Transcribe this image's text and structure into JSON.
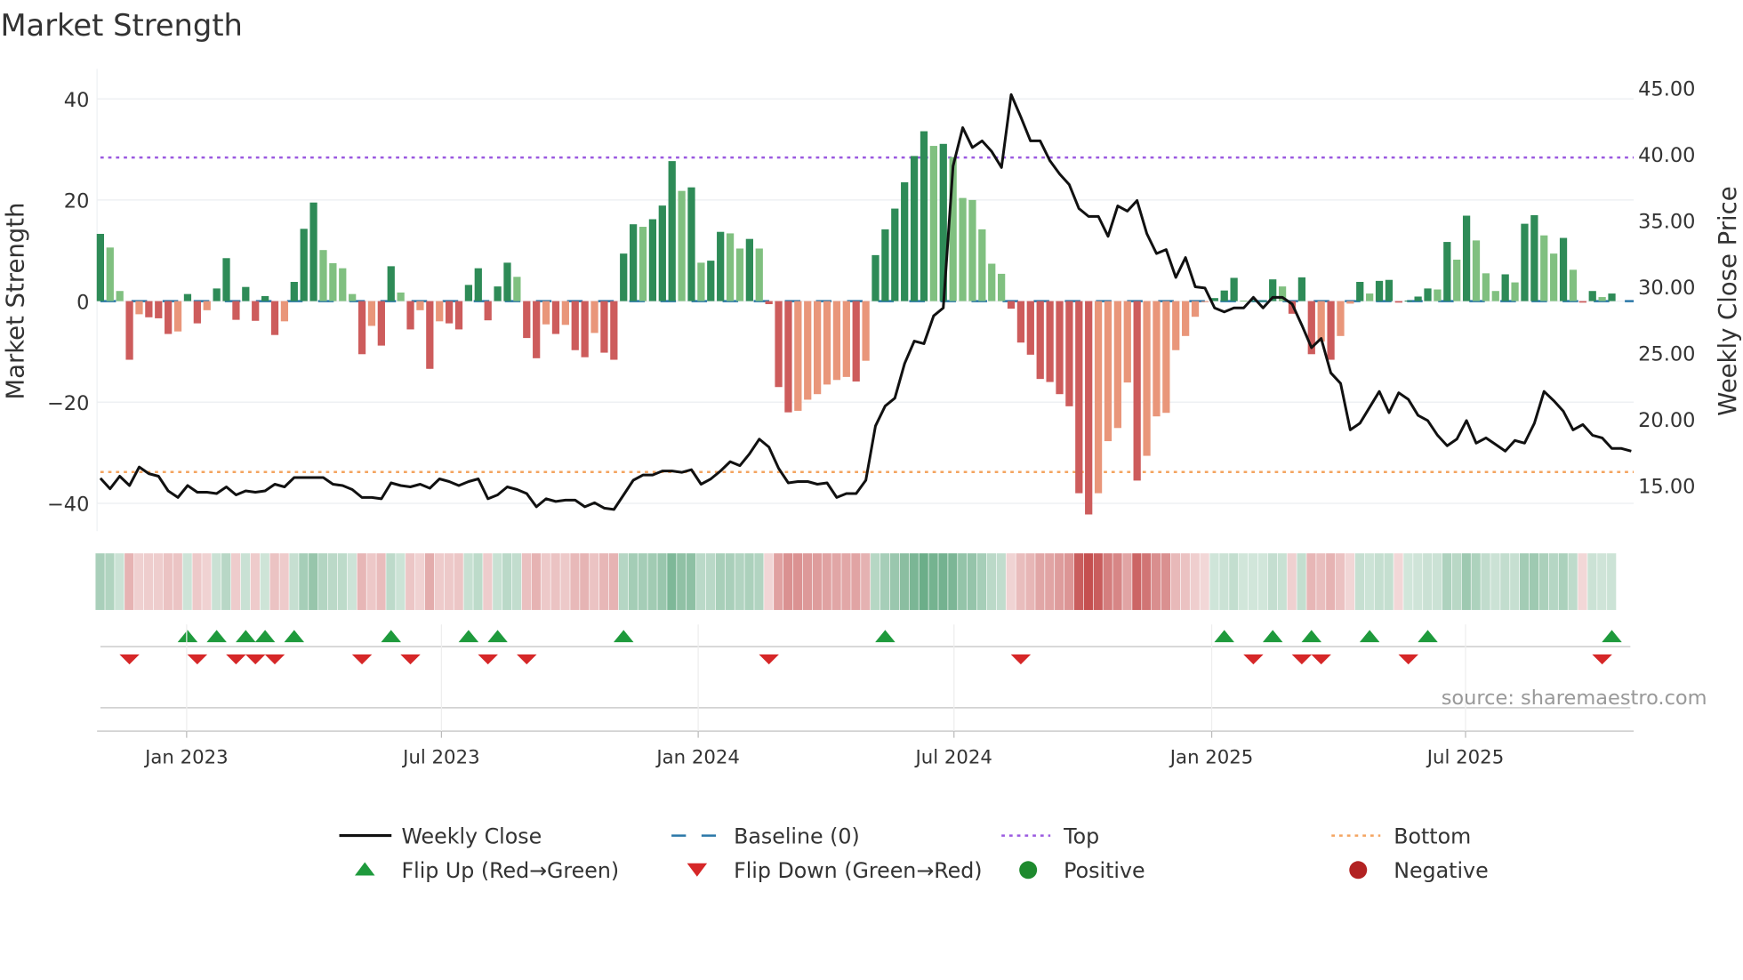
{
  "chart_data": {
    "type": "bar",
    "title": "Market Strength",
    "ylabel": "Market Strength",
    "y2label": "Weekly Close Price",
    "ylim": [
      -45,
      45
    ],
    "y2lim": [
      12.8,
      46.3
    ],
    "yticks": [
      40,
      20,
      0,
      -20,
      -40
    ],
    "yticklabels": [
      "40",
      "20",
      "0",
      "−20",
      "−40"
    ],
    "y2ticks": [
      45,
      40,
      35,
      30,
      25,
      20,
      15
    ],
    "y2ticklabels": [
      "45.00",
      "40.00",
      "35.00",
      "30.00",
      "25.00",
      "20.00",
      "15.00"
    ],
    "x_ticks": [
      {
        "label": "Jan 2023",
        "week": 8.9
      },
      {
        "label": "Jul 2023",
        "week": 35.2
      },
      {
        "label": "Jan 2024",
        "week": 61.7
      },
      {
        "label": "Jul 2024",
        "week": 88.1
      },
      {
        "label": "Jan 2025",
        "week": 114.7
      },
      {
        "label": "Jul 2025",
        "week": 140.9
      }
    ],
    "top_level": 28.4,
    "bottom_level": -33.8,
    "strength": [
      13.3,
      10.6,
      2.0,
      -11.6,
      -2.6,
      -3.2,
      -3.4,
      -6.5,
      -6.0,
      1.4,
      -4.4,
      -1.8,
      2.5,
      8.5,
      -3.7,
      2.8,
      -3.9,
      1.0,
      -6.7,
      -4.0,
      3.8,
      14.3,
      19.5,
      10.1,
      7.5,
      6.5,
      1.4,
      -10.5,
      -4.9,
      -8.8,
      6.9,
      1.7,
      -5.6,
      -1.8,
      -13.4,
      -4.0,
      -4.4,
      -5.6,
      3.2,
      6.5,
      -3.8,
      2.9,
      7.6,
      4.8,
      -7.3,
      -11.3,
      -4.6,
      -6.5,
      -4.7,
      -9.7,
      -11.1,
      -6.3,
      -10.2,
      -11.6,
      9.4,
      15.2,
      14.7,
      16.2,
      18.9,
      27.7,
      21.8,
      22.5,
      7.6,
      8.0,
      13.7,
      13.4,
      10.4,
      12.3,
      10.4,
      -0.6,
      -17.0,
      -22.0,
      -21.7,
      -19.5,
      -18.4,
      -16.5,
      -15.6,
      -15.0,
      -15.9,
      -11.8,
      9.1,
      14.2,
      18.3,
      23.5,
      28.7,
      33.6,
      30.7,
      31.1,
      28.5,
      20.4,
      20.0,
      14.2,
      7.4,
      5.4,
      -1.5,
      -8.2,
      -10.6,
      -15.4,
      -16.0,
      -18.4,
      -20.8,
      -38.0,
      -42.2,
      -38.0,
      -27.7,
      -25.1,
      -16.1,
      -35.5,
      -30.6,
      -22.8,
      -22.1,
      -9.7,
      -6.9,
      -3.1,
      -0.2,
      0.6,
      2.1,
      4.6,
      0.1,
      0.1,
      0.1,
      4.3,
      2.9,
      -2.5,
      4.7,
      -10.5,
      -8.0,
      -11.6,
      -6.9,
      -0.5,
      3.8,
      1.5,
      4.0,
      4.2,
      -0.3,
      0.1,
      0.9,
      2.5,
      2.3,
      11.7,
      8.2,
      16.9,
      12.0,
      5.5,
      2.0,
      5.3,
      3.7,
      15.3,
      17.0,
      13.0,
      9.4,
      12.5,
      6.2,
      -0.3,
      2.0,
      0.8,
      1.5
    ],
    "weekly_close": [
      15.55,
      14.76,
      15.7,
      15.0,
      16.4,
      15.9,
      15.7,
      14.6,
      14.1,
      15.0,
      14.5,
      14.5,
      14.4,
      14.9,
      14.3,
      14.6,
      14.5,
      14.6,
      15.1,
      14.9,
      15.6,
      15.6,
      15.6,
      15.6,
      15.1,
      15.0,
      14.7,
      14.1,
      14.1,
      14.0,
      15.2,
      15.0,
      14.9,
      15.1,
      14.8,
      15.5,
      15.3,
      15.0,
      15.3,
      15.5,
      14.0,
      14.3,
      14.9,
      14.7,
      14.4,
      13.4,
      14.0,
      13.8,
      13.9,
      13.9,
      13.4,
      13.7,
      13.3,
      13.2,
      14.3,
      15.4,
      15.8,
      15.8,
      16.1,
      16.1,
      16.0,
      16.2,
      15.1,
      15.5,
      16.1,
      16.8,
      16.5,
      17.4,
      18.5,
      17.9,
      16.3,
      15.2,
      15.3,
      15.3,
      15.1,
      15.2,
      14.1,
      14.4,
      14.4,
      15.4,
      19.5,
      21.0,
      21.6,
      24.2,
      25.9,
      25.7,
      27.8,
      28.4,
      39.1,
      42.0,
      40.5,
      41.0,
      40.2,
      39.0,
      44.5,
      42.8,
      41.0,
      41.0,
      39.5,
      38.5,
      37.7,
      35.9,
      35.3,
      35.3,
      33.8,
      36.1,
      35.7,
      36.5,
      34.0,
      32.5,
      32.8,
      30.7,
      32.2,
      30.0,
      29.9,
      28.4,
      28.1,
      28.4,
      28.4,
      29.2,
      28.4,
      29.2,
      29.2,
      28.7,
      27.1,
      25.4,
      26.1,
      23.5,
      22.7,
      19.2,
      19.7,
      20.9,
      22.1,
      20.5,
      22.0,
      21.5,
      20.3,
      19.9,
      18.8,
      18.0,
      18.5,
      19.9,
      18.2,
      18.6,
      18.1,
      17.6,
      18.4,
      18.2,
      19.7,
      22.1,
      21.4,
      20.6,
      19.2,
      19.6,
      18.8,
      18.6,
      17.8,
      17.8,
      17.6
    ],
    "flip_up_weeks": [
      9,
      12,
      15,
      17,
      20,
      30,
      38,
      41,
      54,
      81,
      116,
      121,
      125,
      131,
      137,
      156
    ],
    "flip_down_weeks": [
      3,
      10,
      14,
      16,
      18,
      27,
      32,
      40,
      44,
      69,
      95,
      119,
      124,
      126,
      135,
      155
    ],
    "legend": [
      {
        "label": "Weekly Close",
        "kind": "line",
        "color": "#111111"
      },
      {
        "label": "Baseline (0)",
        "kind": "dash",
        "color": "#2a77a8"
      },
      {
        "label": "Top",
        "kind": "dot",
        "color": "#9b59e0"
      },
      {
        "label": "Bottom",
        "kind": "dot",
        "color": "#f4a460"
      },
      {
        "label": "Flip Up (Red→Green)",
        "kind": "tri-up",
        "color": "#1e9a3c"
      },
      {
        "label": "Flip Down (Green→Red)",
        "kind": "tri-down",
        "color": "#d62728"
      },
      {
        "label": "Positive",
        "kind": "circle",
        "color": "#1e8a2e"
      },
      {
        "label": "Negative",
        "kind": "circle",
        "color": "#b22222"
      }
    ],
    "legend_placement": "bottom",
    "colors": {
      "pos_rising": "#2e8b57",
      "pos_falling": "#80c080",
      "neg_falling": "#cd5c5c",
      "neg_rising": "#e9967a"
    }
  },
  "source": "source: sharemaestro.com"
}
